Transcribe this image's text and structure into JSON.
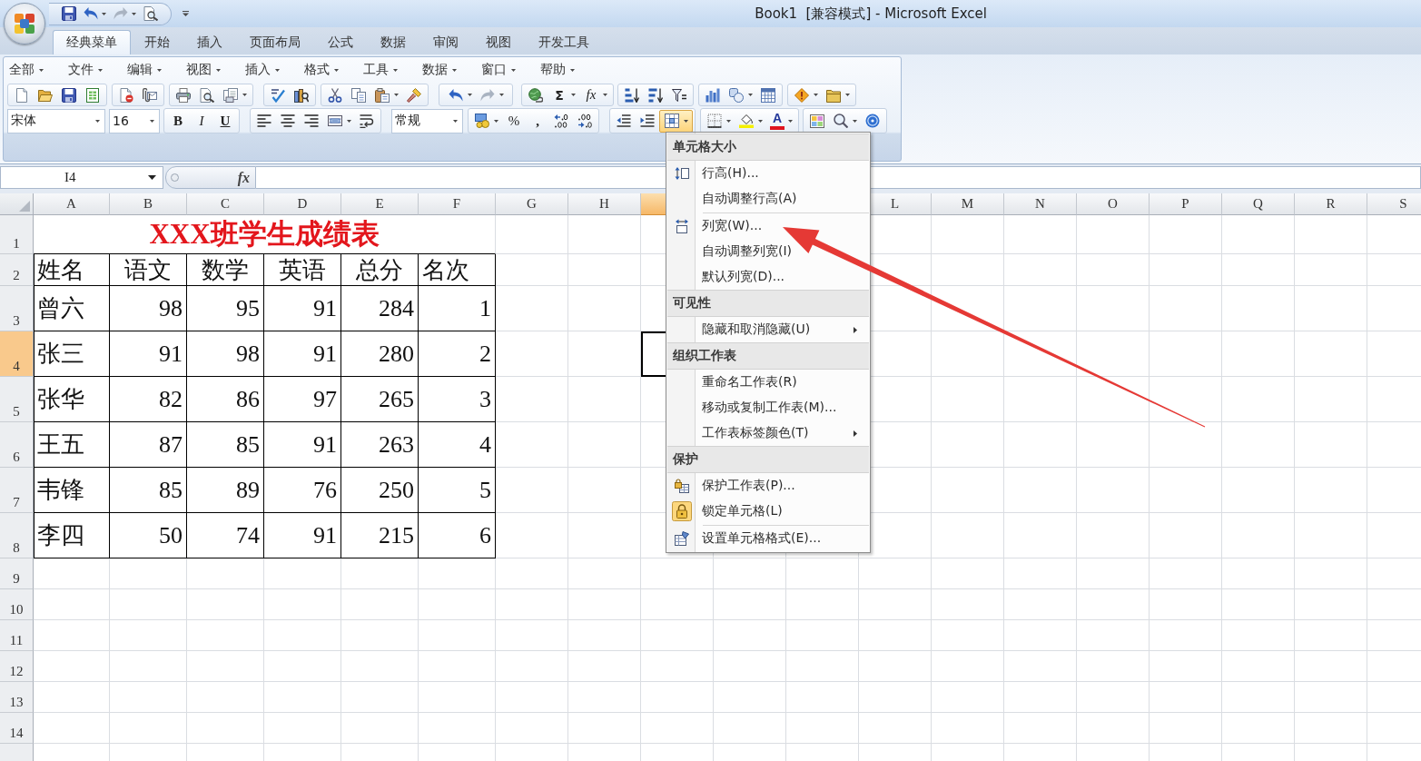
{
  "window": {
    "title": "Book1  [兼容模式] - Microsoft Excel"
  },
  "ribbon_tabs": [
    {
      "label": "经典菜单",
      "selected": true
    },
    {
      "label": "开始",
      "selected": false
    },
    {
      "label": "插入",
      "selected": false
    },
    {
      "label": "页面布局",
      "selected": false
    },
    {
      "label": "公式",
      "selected": false
    },
    {
      "label": "数据",
      "selected": false
    },
    {
      "label": "审阅",
      "selected": false
    },
    {
      "label": "视图",
      "selected": false
    },
    {
      "label": "开发工具",
      "selected": false
    }
  ],
  "classic_menus": [
    "全部",
    "文件",
    "编辑",
    "视图",
    "插入",
    "格式",
    "工具",
    "数据",
    "窗口",
    "帮助"
  ],
  "standard_toolbar": {
    "sum": "Σ",
    "function": "fx"
  },
  "formatting_toolbar": {
    "font": "宋体",
    "font_size": "16",
    "bold": "B",
    "italic": "I",
    "underline": "U",
    "number_format": "常规",
    "percent": "%",
    "comma": ",",
    "font_color": "A",
    "cell_size_menu": {
      "expanded": true
    }
  },
  "formula_bar": {
    "name_box": "I4",
    "function_button": "fx"
  },
  "sheet": {
    "columns": [
      {
        "label": "A",
        "selected": false
      },
      {
        "label": "B",
        "selected": false
      },
      {
        "label": "C",
        "selected": false
      },
      {
        "label": "D",
        "selected": false
      },
      {
        "label": "E",
        "selected": false
      },
      {
        "label": "F",
        "selected": false
      },
      {
        "label": "G",
        "selected": false
      },
      {
        "label": "H",
        "selected": false
      },
      {
        "selected": true
      },
      {},
      {},
      {
        "label": "L",
        "selected": false
      },
      {
        "label": "M",
        "selected": false
      },
      {
        "label": "N",
        "selected": false
      },
      {
        "label": "O",
        "selected": false
      },
      {
        "label": "P",
        "selected": false
      },
      {
        "label": "Q",
        "selected": false
      },
      {
        "label": "R",
        "selected": false
      },
      {
        "label": "S",
        "selected": false
      }
    ],
    "rows": [
      {
        "label": "1",
        "selected": false
      },
      {
        "label": "2",
        "selected": false
      },
      {
        "label": "3",
        "selected": false
      },
      {
        "label": "4",
        "selected": true
      },
      {
        "label": "5",
        "selected": false
      },
      {
        "label": "6",
        "selected": false
      },
      {
        "label": "7",
        "selected": false
      },
      {
        "label": "8",
        "selected": false
      },
      {
        "label": "9",
        "selected": false
      },
      {
        "label": "10",
        "selected": false
      },
      {
        "label": "11",
        "selected": false
      },
      {
        "label": "12",
        "selected": false
      },
      {
        "label": "13",
        "selected": false
      },
      {
        "label": "14",
        "selected": false
      }
    ],
    "title": "XXX班学生成绩表",
    "table": {
      "columns": [
        "姓名",
        "语文",
        "数学",
        "英语",
        "总分",
        "名次"
      ],
      "rows": [
        [
          "曾六",
          "98",
          "95",
          "91",
          "284",
          "1"
        ],
        [
          "张三",
          "91",
          "98",
          "91",
          "280",
          "2"
        ],
        [
          "张华",
          "82",
          "86",
          "97",
          "265",
          "3"
        ],
        [
          "王五",
          "87",
          "85",
          "91",
          "263",
          "4"
        ],
        [
          "韦锋",
          "85",
          "89",
          "76",
          "250",
          "5"
        ],
        [
          "李四",
          "50",
          "74",
          "91",
          "215",
          "6"
        ]
      ]
    }
  },
  "context_menu": {
    "sections": [
      {
        "heading": "单元格大小",
        "groups": [
          [
            {
              "kind": "rows",
              "label": "行高(H)...",
              "checked": false,
              "submenu": false
            },
            {
              "kind": "plain",
              "label": "自动调整行高(A)",
              "checked": false,
              "submenu": false
            }
          ],
          [
            {
              "kind": "columns",
              "label": "列宽(W)...",
              "checked": false,
              "submenu": false
            },
            {
              "kind": "plain",
              "label": "自动调整列宽(I)",
              "checked": false,
              "submenu": false
            },
            {
              "kind": "plain",
              "label": "默认列宽(D)...",
              "checked": false,
              "submenu": false
            }
          ]
        ]
      },
      {
        "heading": "可见性",
        "groups": [
          [
            {
              "kind": "plain",
              "label": "隐藏和取消隐藏(U)",
              "checked": false,
              "submenu": true
            }
          ]
        ]
      },
      {
        "heading": "组织工作表",
        "groups": [
          [
            {
              "kind": "plain",
              "label": "重命名工作表(R)",
              "checked": false,
              "submenu": false
            },
            {
              "kind": "plain",
              "label": "移动或复制工作表(M)...",
              "checked": false,
              "submenu": false
            },
            {
              "kind": "plain",
              "label": "工作表标签颜色(T)",
              "checked": false,
              "submenu": true
            }
          ]
        ]
      },
      {
        "heading": "保护",
        "groups": [
          [
            {
              "kind": "protect",
              "label": "保护工作表(P)...",
              "checked": false,
              "submenu": false
            },
            {
              "kind": "lock",
              "label": "锁定单元格(L)",
              "checked": true,
              "submenu": false
            }
          ],
          [
            {
              "kind": "format",
              "label": "设置单元格格式(E)...",
              "checked": false,
              "submenu": false
            }
          ]
        ]
      }
    ]
  }
}
